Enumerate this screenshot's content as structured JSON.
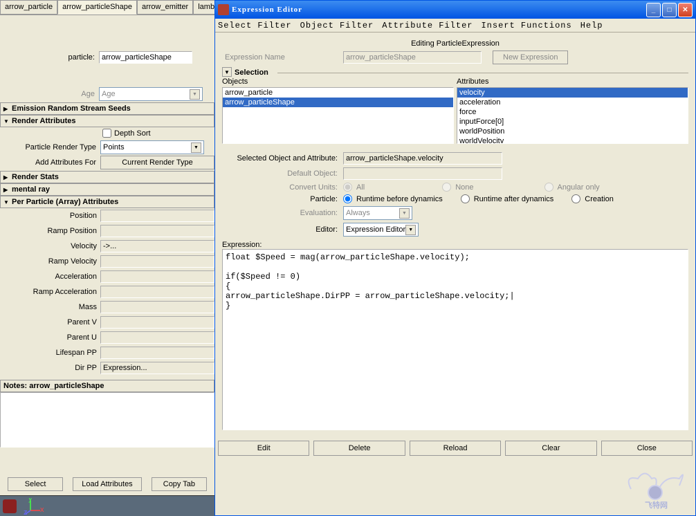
{
  "left": {
    "tabs": [
      "arrow_particle",
      "arrow_particleShape",
      "arrow_emitter",
      "lambe"
    ],
    "particle_label": "particle:",
    "particle_value": "arrow_particleShape",
    "age_label": "Age",
    "age_value": "Age",
    "sections": {
      "emission_seeds": "Emission Random Stream Seeds",
      "render_attrs": "Render Attributes",
      "render_stats": "Render Stats",
      "mental_ray": "mental ray",
      "per_particle": "Per Particle (Array) Attributes"
    },
    "depth_sort": "Depth Sort",
    "particle_render_type": "Particle Render Type",
    "particle_render_type_value": "Points",
    "add_attrs_for": "Add Attributes For",
    "current_render_type": "Current Render Type",
    "attrs": {
      "position": "Position",
      "ramp_position": "Ramp Position",
      "velocity": "Velocity",
      "velocity_val": "->...",
      "ramp_velocity": "Ramp Velocity",
      "acceleration": "Acceleration",
      "ramp_acceleration": "Ramp Acceleration",
      "mass": "Mass",
      "parent_v": "Parent V",
      "parent_u": "Parent U",
      "lifespan_pp": "Lifespan PP",
      "dir_pp": "Dir PP",
      "dir_pp_val": "Expression..."
    },
    "notes_label": "Notes:  arrow_particleShape",
    "buttons": {
      "select": "Select",
      "load": "Load Attributes",
      "copy": "Copy Tab"
    }
  },
  "editor": {
    "title": "Expression Editor",
    "menu": [
      "Select Filter",
      "Object Filter",
      "Attribute Filter",
      "Insert Functions",
      "Help"
    ],
    "editing_text": "Editing ParticleExpression",
    "expr_name_label": "Expression Name",
    "expr_name_value": "arrow_particleShape",
    "new_expression": "New Expression",
    "selection_label": "Selection",
    "objects_label": "Objects",
    "attributes_label": "Attributes",
    "objects": [
      "arrow_particle",
      "arrow_particleShape"
    ],
    "objects_selected": 1,
    "attributes": [
      "velocity",
      "acceleration",
      "force",
      "inputForce[0]",
      "worldPosition",
      "worldVelocity"
    ],
    "attributes_selected": 0,
    "selected_obj_attr_label": "Selected Object and Attribute:",
    "selected_obj_attr_value": "arrow_particleShape.velocity",
    "default_object_label": "Default Object:",
    "convert_units_label": "Convert Units:",
    "convert_units": {
      "all": "All",
      "none": "None",
      "angular": "Angular only"
    },
    "particle_label": "Particle:",
    "particle_opts": {
      "before": "Runtime before dynamics",
      "after": "Runtime after dynamics",
      "creation": "Creation"
    },
    "evaluation_label": "Evaluation:",
    "evaluation_value": "Always",
    "editor_label": "Editor:",
    "editor_value": "Expression Editor",
    "expression_label": "Expression:",
    "expression_code": "float $Speed = mag(arrow_particleShape.velocity);\n\nif($Speed != 0)\n{\narrow_particleShape.DirPP = arrow_particleShape.velocity;|\n}",
    "buttons": {
      "edit": "Edit",
      "delete": "Delete",
      "reload": "Reload",
      "clear": "Clear",
      "close": "Close"
    }
  }
}
